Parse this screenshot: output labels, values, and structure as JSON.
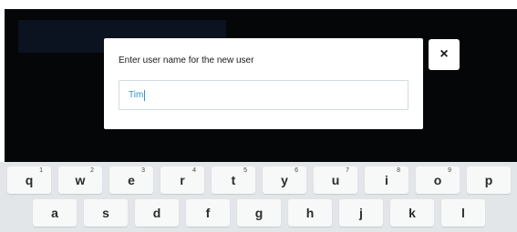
{
  "dialog": {
    "prompt": "Enter user name for the new user",
    "input_value": "Tim"
  },
  "close_button": {
    "label": "×",
    "icon": "close-icon"
  },
  "keyboard": {
    "row1": [
      {
        "key": "q",
        "hint": "1"
      },
      {
        "key": "w",
        "hint": "2"
      },
      {
        "key": "e",
        "hint": "3"
      },
      {
        "key": "r",
        "hint": "4"
      },
      {
        "key": "t",
        "hint": "5"
      },
      {
        "key": "y",
        "hint": "6"
      },
      {
        "key": "u",
        "hint": "7"
      },
      {
        "key": "i",
        "hint": "8"
      },
      {
        "key": "o",
        "hint": "9"
      },
      {
        "key": "p",
        "hint": ""
      }
    ],
    "row2": [
      {
        "key": "a"
      },
      {
        "key": "s"
      },
      {
        "key": "d"
      },
      {
        "key": "f"
      },
      {
        "key": "g"
      },
      {
        "key": "h"
      },
      {
        "key": "j"
      },
      {
        "key": "k"
      },
      {
        "key": "l"
      }
    ]
  },
  "colors": {
    "app_background": "#050608",
    "input_text": "#2a95cf",
    "keyboard_background": "#e3e6e8"
  }
}
